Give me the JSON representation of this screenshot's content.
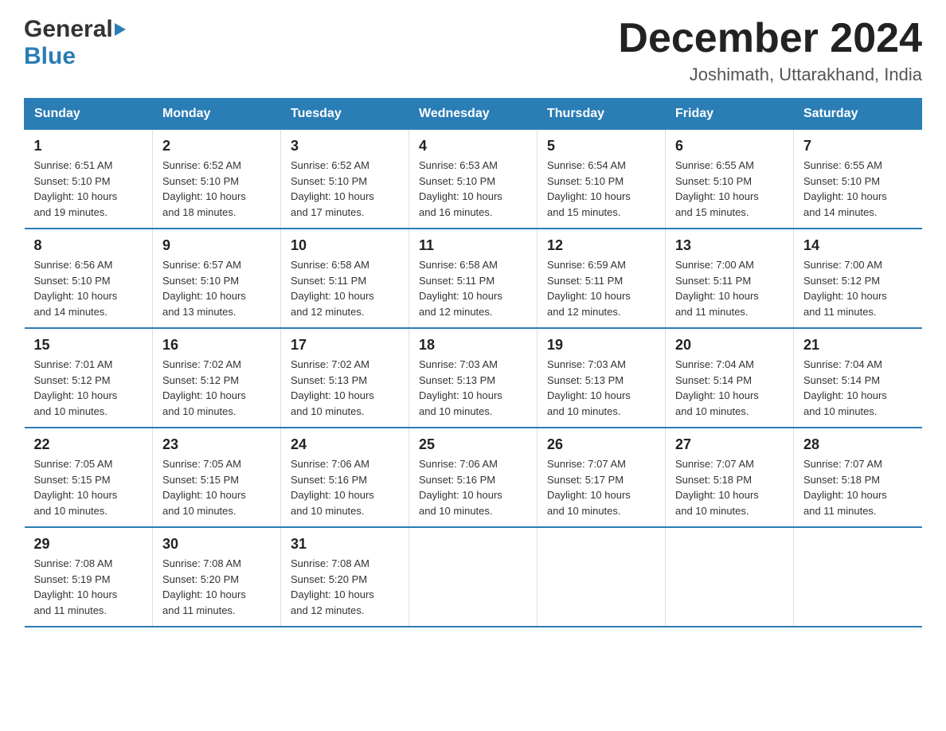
{
  "logo": {
    "general": "General",
    "blue": "Blue",
    "arrow": "▶"
  },
  "title": "December 2024",
  "location": "Joshimath, Uttarakhand, India",
  "headers": [
    "Sunday",
    "Monday",
    "Tuesday",
    "Wednesday",
    "Thursday",
    "Friday",
    "Saturday"
  ],
  "weeks": [
    [
      {
        "day": "1",
        "sunrise": "6:51 AM",
        "sunset": "5:10 PM",
        "daylight": "10 hours and 19 minutes."
      },
      {
        "day": "2",
        "sunrise": "6:52 AM",
        "sunset": "5:10 PM",
        "daylight": "10 hours and 18 minutes."
      },
      {
        "day": "3",
        "sunrise": "6:52 AM",
        "sunset": "5:10 PM",
        "daylight": "10 hours and 17 minutes."
      },
      {
        "day": "4",
        "sunrise": "6:53 AM",
        "sunset": "5:10 PM",
        "daylight": "10 hours and 16 minutes."
      },
      {
        "day": "5",
        "sunrise": "6:54 AM",
        "sunset": "5:10 PM",
        "daylight": "10 hours and 15 minutes."
      },
      {
        "day": "6",
        "sunrise": "6:55 AM",
        "sunset": "5:10 PM",
        "daylight": "10 hours and 15 minutes."
      },
      {
        "day": "7",
        "sunrise": "6:55 AM",
        "sunset": "5:10 PM",
        "daylight": "10 hours and 14 minutes."
      }
    ],
    [
      {
        "day": "8",
        "sunrise": "6:56 AM",
        "sunset": "5:10 PM",
        "daylight": "10 hours and 14 minutes."
      },
      {
        "day": "9",
        "sunrise": "6:57 AM",
        "sunset": "5:10 PM",
        "daylight": "10 hours and 13 minutes."
      },
      {
        "day": "10",
        "sunrise": "6:58 AM",
        "sunset": "5:11 PM",
        "daylight": "10 hours and 12 minutes."
      },
      {
        "day": "11",
        "sunrise": "6:58 AM",
        "sunset": "5:11 PM",
        "daylight": "10 hours and 12 minutes."
      },
      {
        "day": "12",
        "sunrise": "6:59 AM",
        "sunset": "5:11 PM",
        "daylight": "10 hours and 12 minutes."
      },
      {
        "day": "13",
        "sunrise": "7:00 AM",
        "sunset": "5:11 PM",
        "daylight": "10 hours and 11 minutes."
      },
      {
        "day": "14",
        "sunrise": "7:00 AM",
        "sunset": "5:12 PM",
        "daylight": "10 hours and 11 minutes."
      }
    ],
    [
      {
        "day": "15",
        "sunrise": "7:01 AM",
        "sunset": "5:12 PM",
        "daylight": "10 hours and 10 minutes."
      },
      {
        "day": "16",
        "sunrise": "7:02 AM",
        "sunset": "5:12 PM",
        "daylight": "10 hours and 10 minutes."
      },
      {
        "day": "17",
        "sunrise": "7:02 AM",
        "sunset": "5:13 PM",
        "daylight": "10 hours and 10 minutes."
      },
      {
        "day": "18",
        "sunrise": "7:03 AM",
        "sunset": "5:13 PM",
        "daylight": "10 hours and 10 minutes."
      },
      {
        "day": "19",
        "sunrise": "7:03 AM",
        "sunset": "5:13 PM",
        "daylight": "10 hours and 10 minutes."
      },
      {
        "day": "20",
        "sunrise": "7:04 AM",
        "sunset": "5:14 PM",
        "daylight": "10 hours and 10 minutes."
      },
      {
        "day": "21",
        "sunrise": "7:04 AM",
        "sunset": "5:14 PM",
        "daylight": "10 hours and 10 minutes."
      }
    ],
    [
      {
        "day": "22",
        "sunrise": "7:05 AM",
        "sunset": "5:15 PM",
        "daylight": "10 hours and 10 minutes."
      },
      {
        "day": "23",
        "sunrise": "7:05 AM",
        "sunset": "5:15 PM",
        "daylight": "10 hours and 10 minutes."
      },
      {
        "day": "24",
        "sunrise": "7:06 AM",
        "sunset": "5:16 PM",
        "daylight": "10 hours and 10 minutes."
      },
      {
        "day": "25",
        "sunrise": "7:06 AM",
        "sunset": "5:16 PM",
        "daylight": "10 hours and 10 minutes."
      },
      {
        "day": "26",
        "sunrise": "7:07 AM",
        "sunset": "5:17 PM",
        "daylight": "10 hours and 10 minutes."
      },
      {
        "day": "27",
        "sunrise": "7:07 AM",
        "sunset": "5:18 PM",
        "daylight": "10 hours and 10 minutes."
      },
      {
        "day": "28",
        "sunrise": "7:07 AM",
        "sunset": "5:18 PM",
        "daylight": "10 hours and 11 minutes."
      }
    ],
    [
      {
        "day": "29",
        "sunrise": "7:08 AM",
        "sunset": "5:19 PM",
        "daylight": "10 hours and 11 minutes."
      },
      {
        "day": "30",
        "sunrise": "7:08 AM",
        "sunset": "5:20 PM",
        "daylight": "10 hours and 11 minutes."
      },
      {
        "day": "31",
        "sunrise": "7:08 AM",
        "sunset": "5:20 PM",
        "daylight": "10 hours and 12 minutes."
      },
      null,
      null,
      null,
      null
    ]
  ],
  "labels": {
    "sunrise": "Sunrise:",
    "sunset": "Sunset:",
    "daylight": "Daylight:"
  }
}
